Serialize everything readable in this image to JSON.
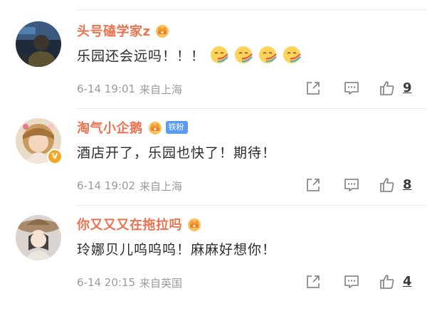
{
  "comments": [
    {
      "username": "头号磕学家z",
      "text": "乐园还会远吗！！！",
      "emoji_count": 4,
      "date": "6-14 19:01",
      "location": "来自上海",
      "likes": "9",
      "fan_badge": ""
    },
    {
      "username": "淘气小企鹅",
      "text": "酒店开了，乐园也快了！期待！",
      "date": "6-14 19:02",
      "location": "来自上海",
      "likes": "8",
      "fan_badge": "铁粉",
      "verified_badge": "V"
    },
    {
      "username": "你又又又在拖拉吗",
      "text": "玲娜贝儿呜呜呜！麻麻好想你！",
      "date": "6-14 20:15",
      "location": "来自英国",
      "likes": "4",
      "fan_badge": ""
    }
  ],
  "icons": {
    "crown": "crown-icon",
    "share": "share-icon",
    "reply": "comment-icon",
    "like": "thumbs-up-icon",
    "emoji": "rainbow-emoji-icon"
  },
  "colors": {
    "username": "#eb7350",
    "meta": "#9a9a9a",
    "fan_badge": "#5b9bf8",
    "text": "#2b2b2b"
  }
}
